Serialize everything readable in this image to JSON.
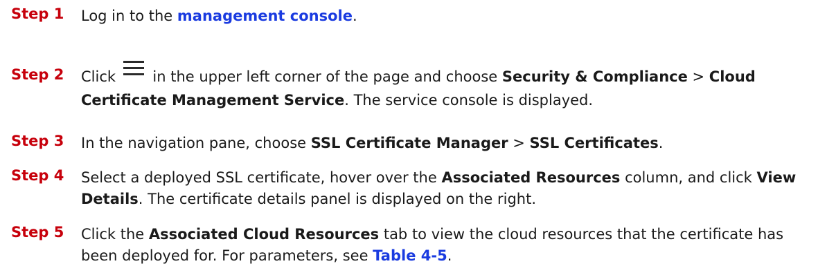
{
  "steps": [
    {
      "label": "Step 1",
      "segments": [
        {
          "t": "text",
          "v": "Log in to the "
        },
        {
          "t": "link",
          "v": "management console"
        },
        {
          "t": "text",
          "v": "."
        }
      ]
    },
    {
      "label": "Step 2",
      "segments": [
        {
          "t": "text",
          "v": "Click "
        },
        {
          "t": "icon",
          "name": "menu-icon"
        },
        {
          "t": "text",
          "v": " in the upper left corner of the page and choose "
        },
        {
          "t": "bold",
          "v": "Security & Compliance"
        },
        {
          "t": "text",
          "v": " > "
        },
        {
          "t": "bold",
          "v": "Cloud Certificate Management Service"
        },
        {
          "t": "text",
          "v": ". The service console is displayed."
        }
      ]
    },
    {
      "label": "Step 3",
      "segments": [
        {
          "t": "text",
          "v": "In the navigation pane, choose "
        },
        {
          "t": "bold",
          "v": "SSL Certificate Manager"
        },
        {
          "t": "text",
          "v": " > "
        },
        {
          "t": "bold",
          "v": "SSL Certificates"
        },
        {
          "t": "text",
          "v": "."
        }
      ]
    },
    {
      "label": "Step 4",
      "segments": [
        {
          "t": "text",
          "v": "Select a deployed SSL certificate, hover over the "
        },
        {
          "t": "bold",
          "v": "Associated Resources"
        },
        {
          "t": "text",
          "v": " column, and click "
        },
        {
          "t": "bold",
          "v": "View Details"
        },
        {
          "t": "text",
          "v": ". The certificate details panel is displayed on the right."
        }
      ]
    },
    {
      "label": "Step 5",
      "segments": [
        {
          "t": "text",
          "v": "Click the "
        },
        {
          "t": "bold",
          "v": "Associated Cloud Resources"
        },
        {
          "t": "text",
          "v": " tab to view the cloud resources that the certificate has been deployed for. For parameters, see "
        },
        {
          "t": "link",
          "v": "Table 4-5"
        },
        {
          "t": "text",
          "v": "."
        }
      ]
    }
  ],
  "colors": {
    "step_label": "#c7000b",
    "link": "#1a3be0",
    "text": "#1a1a1a"
  }
}
